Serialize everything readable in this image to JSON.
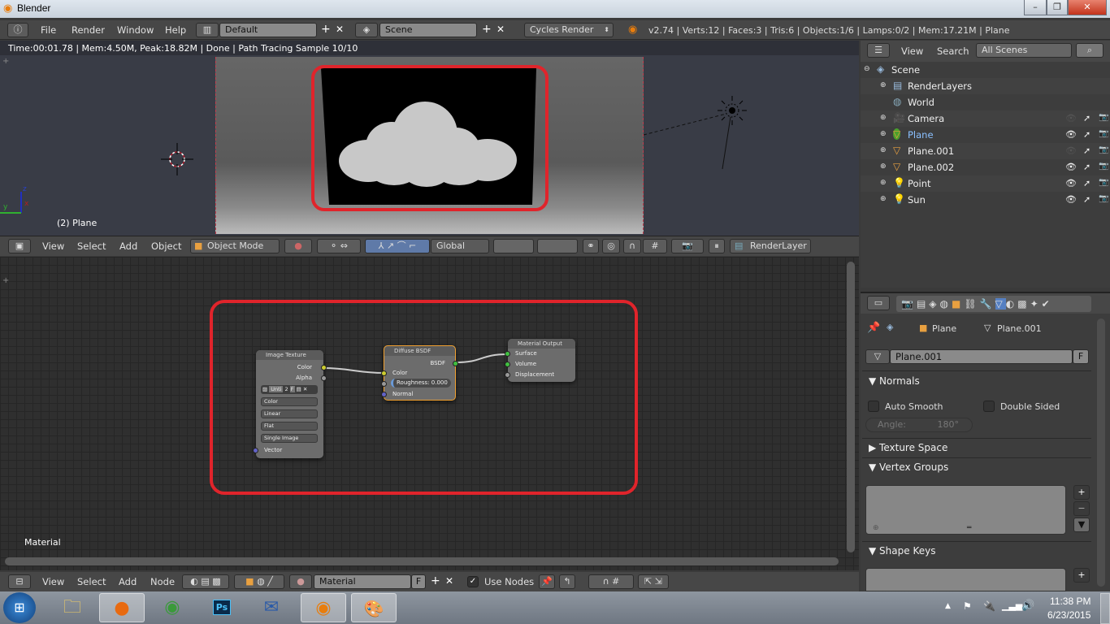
{
  "window": {
    "title": "Blender",
    "controls": {
      "minimize": "–",
      "restore": "❐",
      "close": "✕"
    }
  },
  "info_header": {
    "menus": [
      "File",
      "Render",
      "Window",
      "Help"
    ],
    "screen_layout": "Default",
    "scene": "Scene",
    "render_engine": "Cycles Render",
    "stats": "v2.74 | Verts:12 | Faces:3 | Tris:6 | Objects:1/6 | Lamps:0/2 | Mem:17.21M | Plane"
  },
  "viewport": {
    "render_status": "Time:00:01.78 | Mem:4.50M, Peak:18.82M | Done | Path Tracing Sample 10/10",
    "object_label": "(2) Plane",
    "axis_labels": {
      "x": "x",
      "y": "y",
      "z": "z"
    },
    "header": {
      "menus": [
        "View",
        "Select",
        "Add",
        "Object"
      ],
      "mode": "Object Mode",
      "orientation": "Global",
      "render_layer": "RenderLayer"
    }
  },
  "node_editor": {
    "label": "Material",
    "nodes": {
      "image_texture": {
        "title": "Image Texture",
        "outputs": [
          "Color",
          "Alpha"
        ],
        "image_name": "Unti",
        "image_users": "2",
        "fake_user": "F",
        "dropdowns": [
          "Color",
          "Linear",
          "Flat",
          "Single Image"
        ],
        "inputs": [
          "Vector"
        ]
      },
      "diffuse_bsdf": {
        "title": "Diffuse BSDF",
        "outputs": [
          "BSDF"
        ],
        "inputs": [
          "Color",
          "Normal"
        ],
        "roughness_label": "Roughness:",
        "roughness_value": "0.000"
      },
      "material_output": {
        "title": "Material Output",
        "inputs": [
          "Surface",
          "Volume",
          "Displacement"
        ]
      }
    },
    "header": {
      "menus": [
        "View",
        "Select",
        "Add",
        "Node"
      ],
      "material": "Material",
      "fake_user": "F",
      "use_nodes_label": "Use Nodes",
      "use_nodes_checked": true
    }
  },
  "outliner": {
    "menus": [
      "View",
      "Search"
    ],
    "filter": "All Scenes",
    "items": [
      {
        "name": "Scene",
        "level": 0,
        "icon": "scene-icon"
      },
      {
        "name": "RenderLayers",
        "level": 1,
        "icon": "renderlayers-icon"
      },
      {
        "name": "World",
        "level": 1,
        "icon": "world-icon"
      },
      {
        "name": "Camera",
        "level": 1,
        "icon": "camera-icon",
        "visible": false
      },
      {
        "name": "Plane",
        "level": 1,
        "icon": "mesh-icon",
        "visible": true,
        "active": true
      },
      {
        "name": "Plane.001",
        "level": 1,
        "icon": "mesh-icon",
        "visible": false
      },
      {
        "name": "Plane.002",
        "level": 1,
        "icon": "mesh-icon",
        "visible": true
      },
      {
        "name": "Point",
        "level": 1,
        "icon": "lamp-icon",
        "visible": true
      },
      {
        "name": "Sun",
        "level": 1,
        "icon": "lamp-icon",
        "visible": true
      }
    ]
  },
  "properties": {
    "breadcrumb": [
      "Plane",
      "Plane.001"
    ],
    "mesh_name": "Plane.001",
    "fake_user": "F",
    "panels": {
      "normals": "Normals",
      "auto_smooth": "Auto Smooth",
      "double_sided": "Double Sided",
      "angle_label": "Angle:",
      "angle_value": "180°",
      "texture_space": "Texture Space",
      "vertex_groups": "Vertex Groups",
      "shape_keys": "Shape Keys"
    }
  },
  "taskbar": {
    "apps": [
      "Start",
      "Windows Explorer",
      "Firefox",
      "Chrome",
      "Photoshop",
      "Thunderbird",
      "Blender",
      "Paint"
    ],
    "time": "11:38 PM",
    "date": "6/23/2015"
  },
  "colors": {
    "highlight_red": "#e0242b",
    "accent_blue": "#5680c2",
    "active_green": "#4aa02c"
  }
}
